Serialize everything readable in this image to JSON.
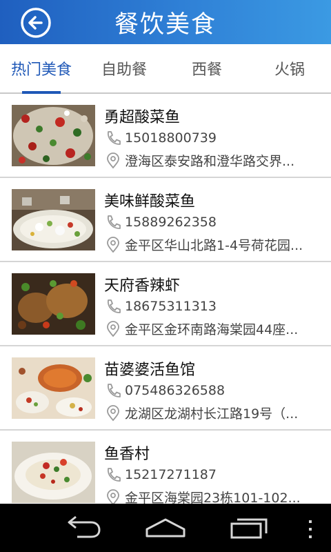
{
  "header": {
    "title": "餐饮美食"
  },
  "tabs": [
    {
      "label": "热门美食",
      "active": true
    },
    {
      "label": "自助餐",
      "active": false
    },
    {
      "label": "西餐",
      "active": false
    },
    {
      "label": "火锅",
      "active": false
    }
  ],
  "restaurants": [
    {
      "name": "勇超酸菜鱼",
      "phone": "15018800739",
      "address": "澄海区泰安路和澄华路交界..."
    },
    {
      "name": "美味鲜酸菜鱼",
      "phone": "15889262358",
      "address": "金平区华山北路1-4号荷花园..."
    },
    {
      "name": "天府香辣虾",
      "phone": "18675311313",
      "address": "金平区金环南路海棠园44座..."
    },
    {
      "name": "苗婆婆活鱼馆",
      "phone": "075486326588",
      "address": "龙湖区龙湖村长江路19号（..."
    },
    {
      "name": "鱼香村",
      "phone": "15217271187",
      "address": "金平区海棠园23栋101-102..."
    }
  ],
  "colors": {
    "accent": "#1f58b7",
    "header_start": "#1f5fbf",
    "header_end": "#3b9ae3"
  },
  "icons": {
    "back": "back-arrow-icon",
    "phone": "phone-icon",
    "location": "location-pin-icon"
  }
}
